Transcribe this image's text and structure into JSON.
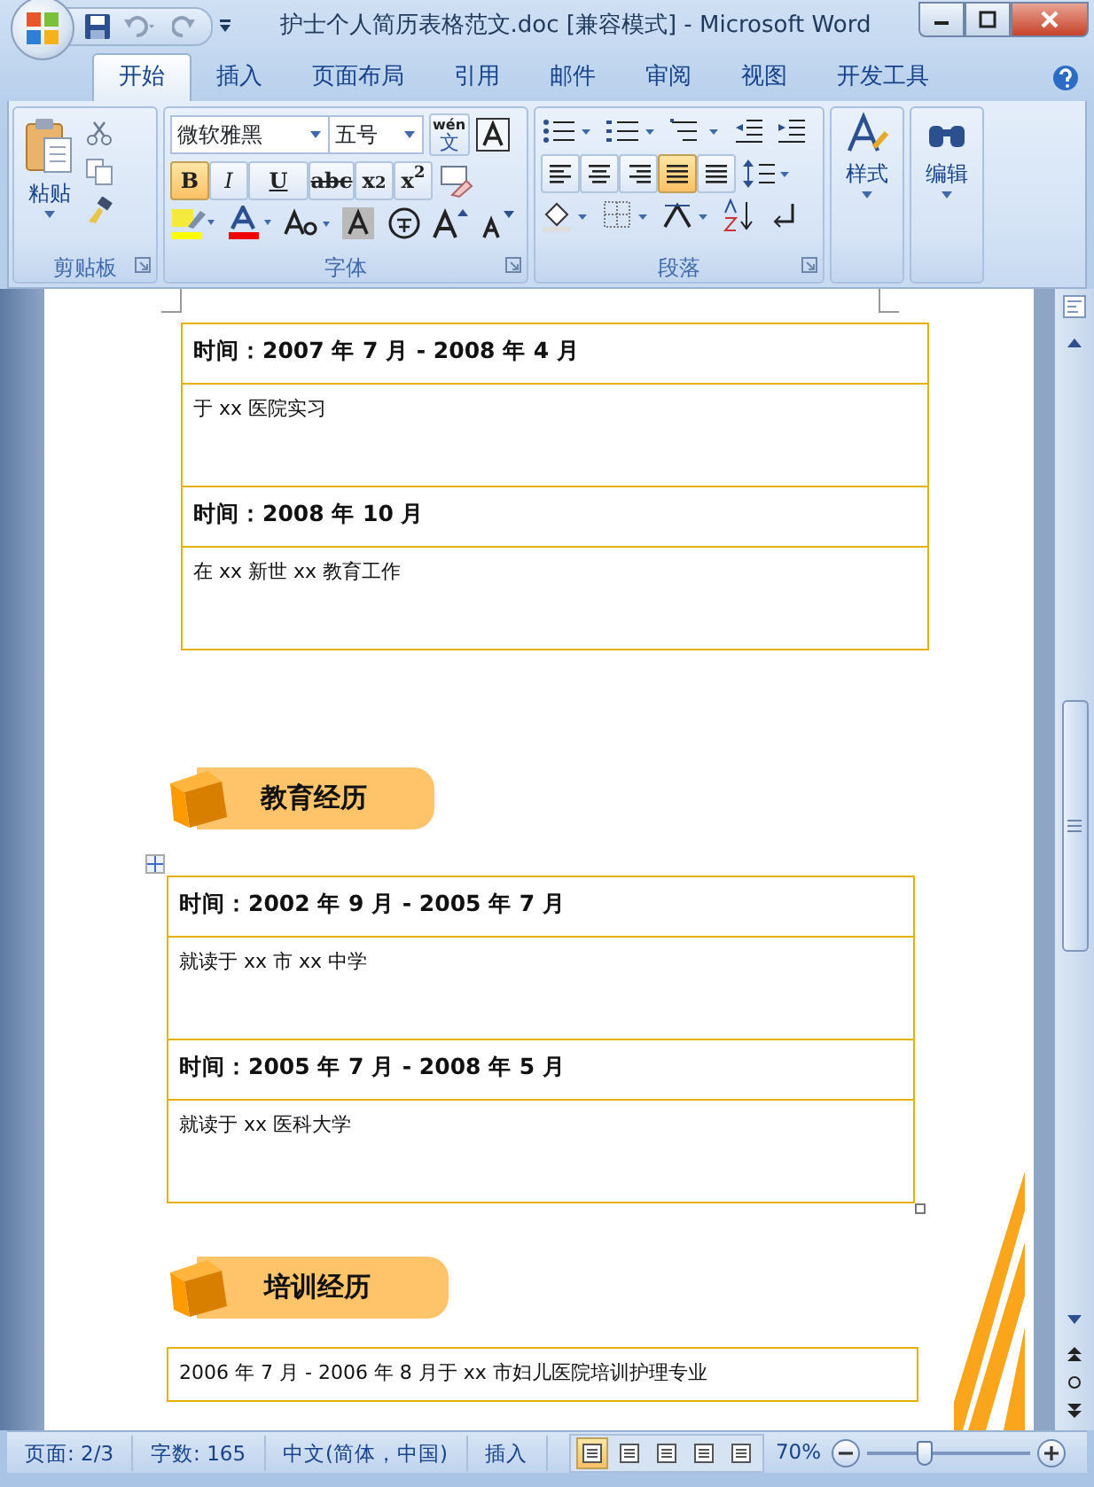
{
  "window": {
    "title": "护士个人简历表格范文.doc [兼容模式]  -  Microsoft Word"
  },
  "tabs": [
    {
      "label": "开始",
      "selected": true
    },
    {
      "label": "插入",
      "selected": false
    },
    {
      "label": "页面布局",
      "selected": false
    },
    {
      "label": "引用",
      "selected": false
    },
    {
      "label": "邮件",
      "selected": false
    },
    {
      "label": "审阅",
      "selected": false
    },
    {
      "label": "视图",
      "selected": false
    },
    {
      "label": "开发工具",
      "selected": false
    }
  ],
  "ribbon": {
    "clipboard": {
      "paste_label": "粘贴",
      "group_label": "剪贴板"
    },
    "font": {
      "font_name": "微软雅黑",
      "font_size": "五号",
      "phonetic_glyph": "wén",
      "phonetic_char": "文",
      "format_buttons": [
        {
          "glyph": "B",
          "on": true
        },
        {
          "glyph": "I",
          "on": false
        },
        {
          "glyph": "U",
          "on": false
        },
        {
          "glyph": "abc",
          "on": false
        },
        {
          "glyph": "x$_{2}$",
          "on": false
        },
        {
          "glyph": "x$^{2}$",
          "on": false
        }
      ],
      "group_label": "字体"
    },
    "paragraph": {
      "align_buttons": [
        {
          "on": false
        },
        {
          "on": false
        },
        {
          "on": false
        },
        {
          "on": true
        },
        {
          "on": false
        }
      ],
      "group_label": "段落"
    },
    "styles": {
      "label": "样式"
    },
    "editing": {
      "label": "编辑"
    }
  },
  "document": {
    "blocks": [
      {
        "kind": "table",
        "rows": [
          {
            "kind": "heading",
            "text": "时间：2007 年 7 月 - 2008 年 4 月"
          },
          {
            "kind": "body",
            "text": "于 xx 医院实习"
          },
          {
            "kind": "heading",
            "text": "时间：2008 年 10 月"
          },
          {
            "kind": "body",
            "text": "在 xx 新世 xx 教育工作"
          }
        ]
      },
      {
        "kind": "section",
        "title": "教育经历"
      },
      {
        "kind": "table",
        "rows": [
          {
            "kind": "heading",
            "text": "时间：2002 年 9 月 - 2005 年 7 月"
          },
          {
            "kind": "body",
            "text": "就读于 xx 市 xx 中学"
          },
          {
            "kind": "heading",
            "text": "时间：2005 年 7 月 - 2008 年 5 月"
          },
          {
            "kind": "body",
            "text": "就读于 xx 医科大学"
          }
        ]
      },
      {
        "kind": "section",
        "title": "培训经历"
      },
      {
        "kind": "table",
        "rows": [
          {
            "kind": "body",
            "text": "2006 年 7 月 - 2006 年 8 月于 xx 市妇儿医院培训护理专业"
          }
        ]
      }
    ]
  },
  "status_bar": {
    "items": [
      "页面: 2/3",
      "字数: 165",
      "中文(简体，中国)",
      "插入"
    ],
    "views": [
      {
        "selected": true
      },
      {
        "selected": false
      },
      {
        "selected": false
      },
      {
        "selected": false
      },
      {
        "selected": false
      }
    ],
    "zoom": "70%",
    "zoom_slider": {
      "level": 0.35
    }
  }
}
